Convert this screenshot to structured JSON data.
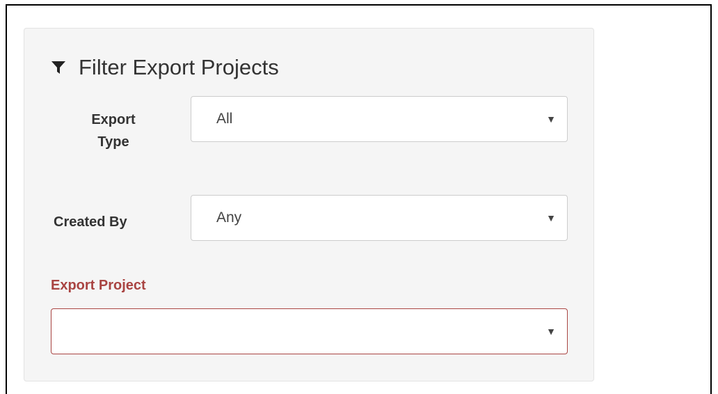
{
  "panel": {
    "title": "Filter Export Projects",
    "icon": "filter-icon"
  },
  "fields": {
    "export_type": {
      "label_line1": "Export",
      "label_line2": "Type",
      "value": "All"
    },
    "created_by": {
      "label": "Created By",
      "value": "Any"
    },
    "export_project": {
      "label": "Export Project",
      "value": ""
    }
  },
  "colors": {
    "error": "#a94442",
    "panel_bg": "#f5f5f5"
  },
  "caret_glyph": "▼"
}
